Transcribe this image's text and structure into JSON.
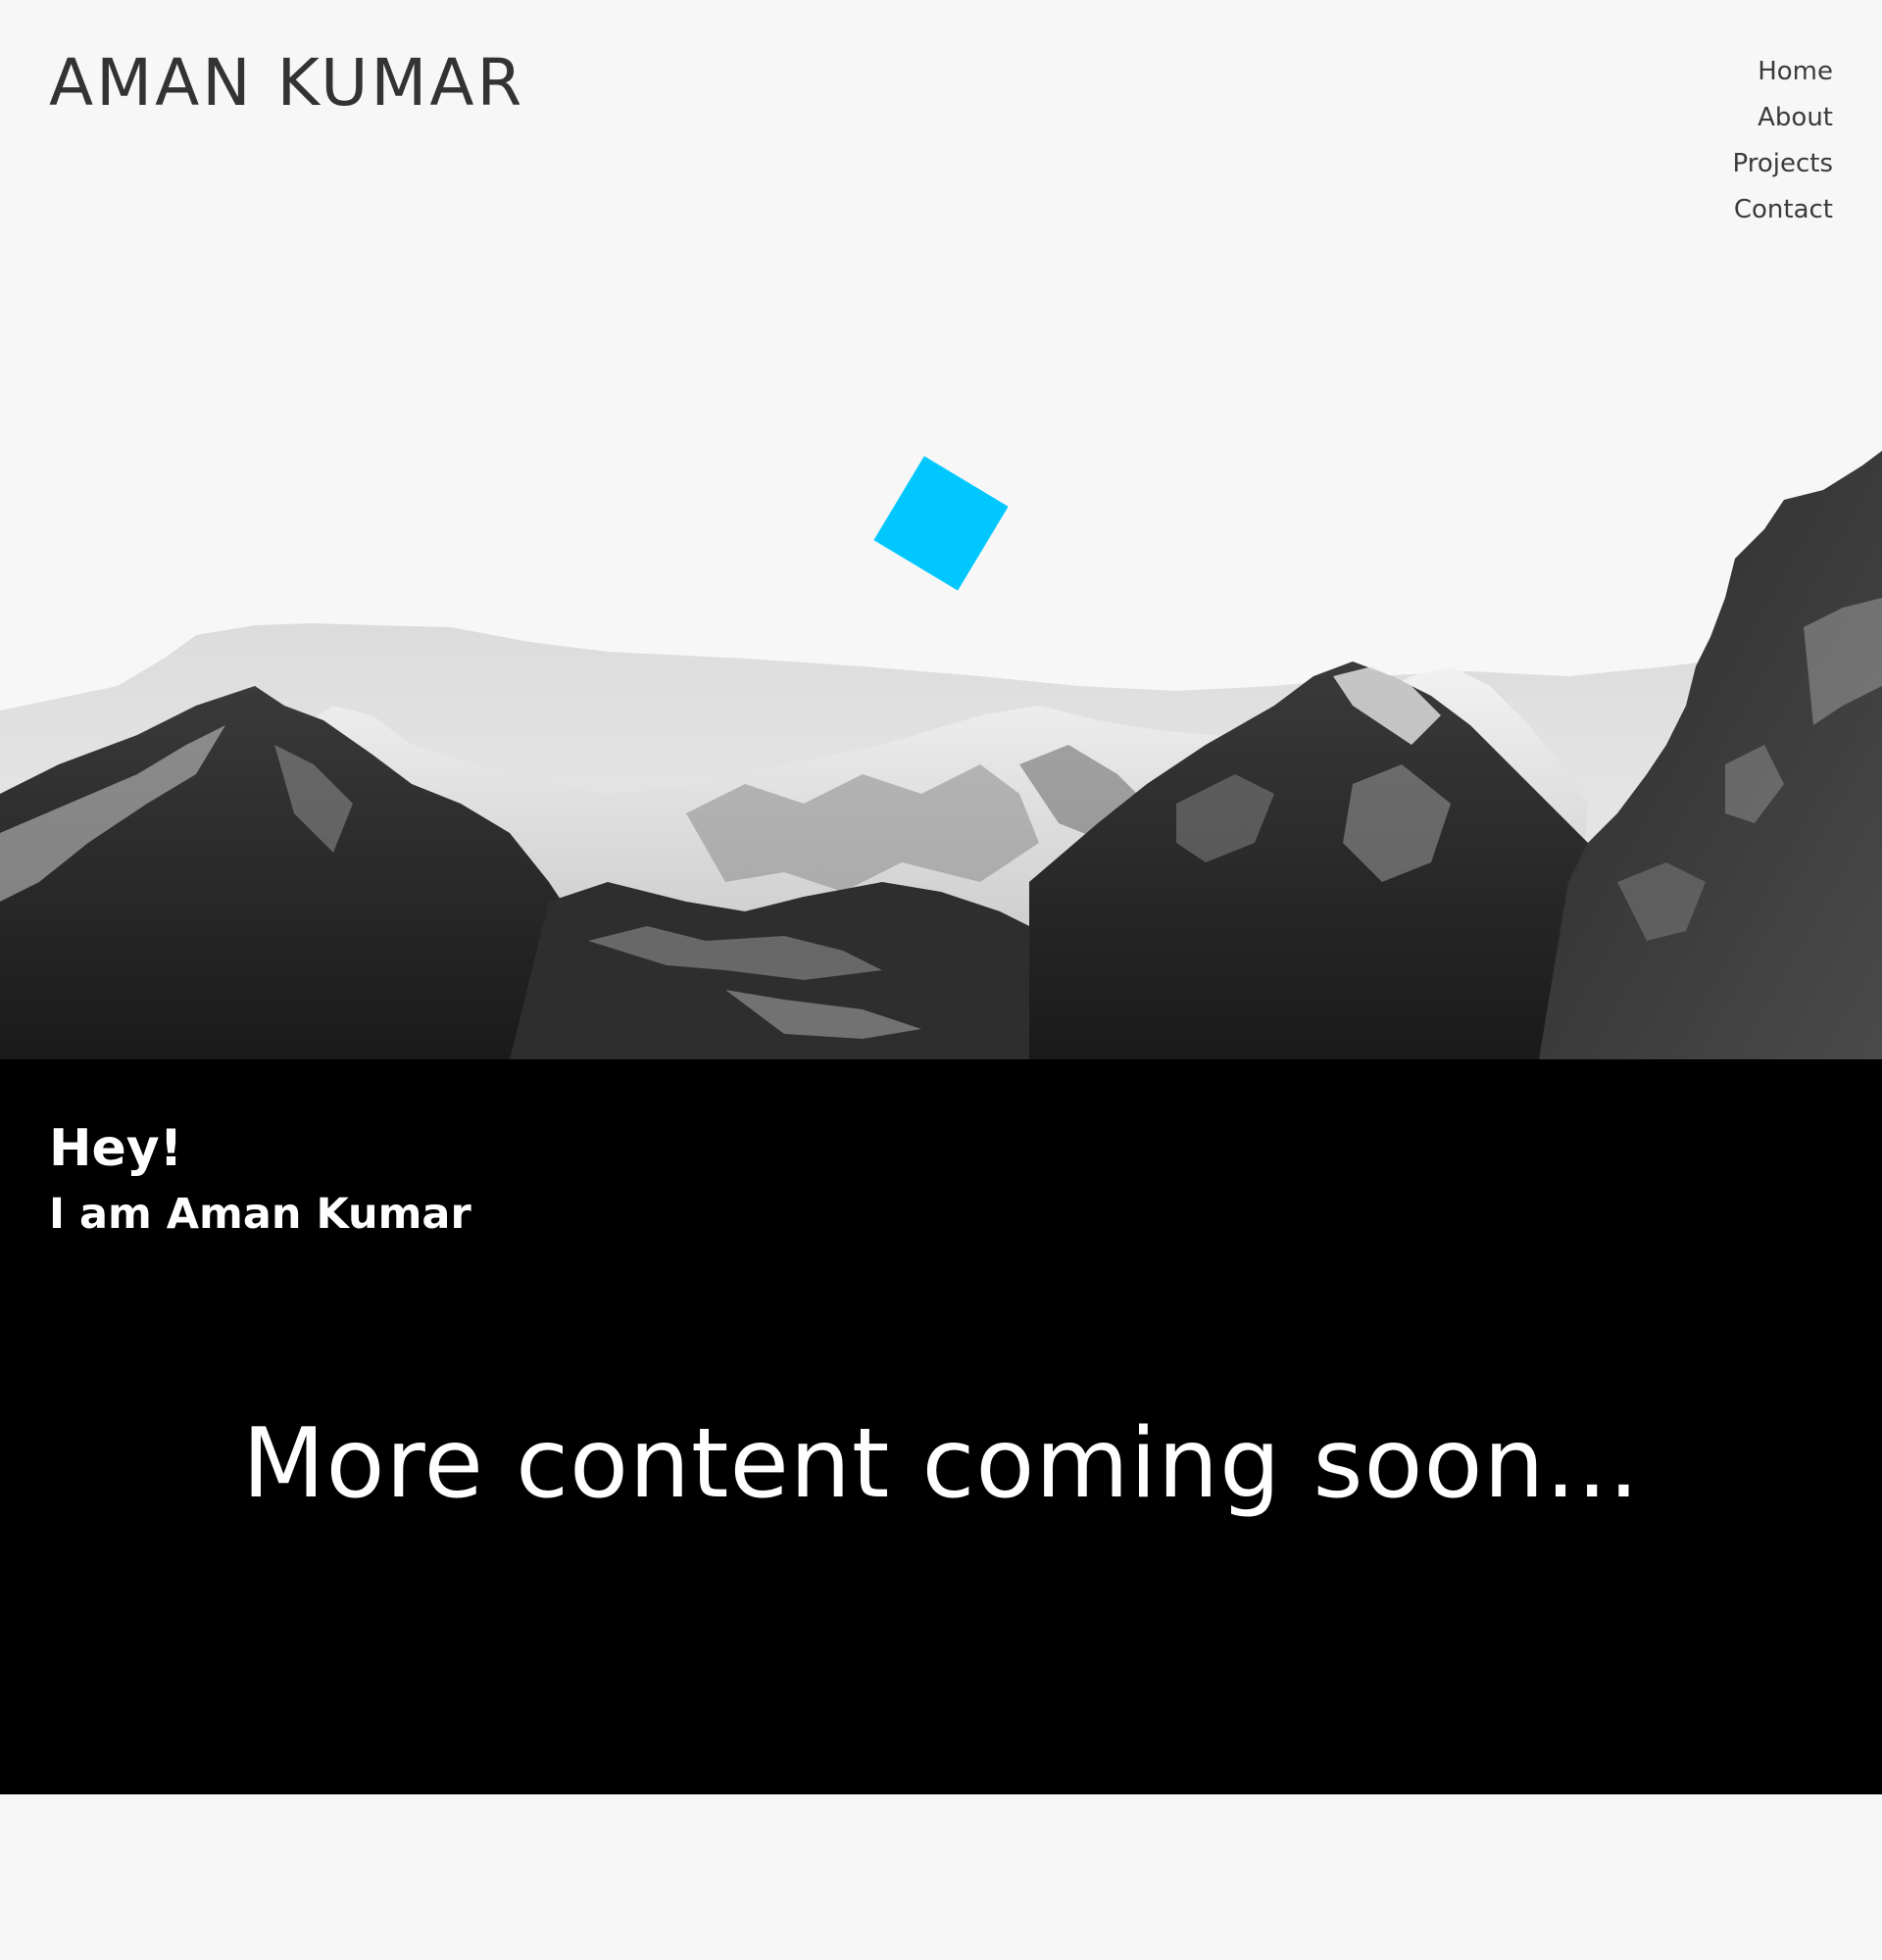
{
  "header": {
    "title": "AMAN KUMAR"
  },
  "nav": {
    "items": [
      {
        "label": "Home"
      },
      {
        "label": "About"
      },
      {
        "label": "Projects"
      },
      {
        "label": "Contact"
      }
    ]
  },
  "hero": {
    "accent_color": "#00c8ff",
    "background_color": "#f7f7f7",
    "image": "mountain-range-black-and-white"
  },
  "intro": {
    "greeting": "Hey!",
    "name_line": "I am Aman Kumar",
    "coming_soon": "More content coming soon..."
  }
}
